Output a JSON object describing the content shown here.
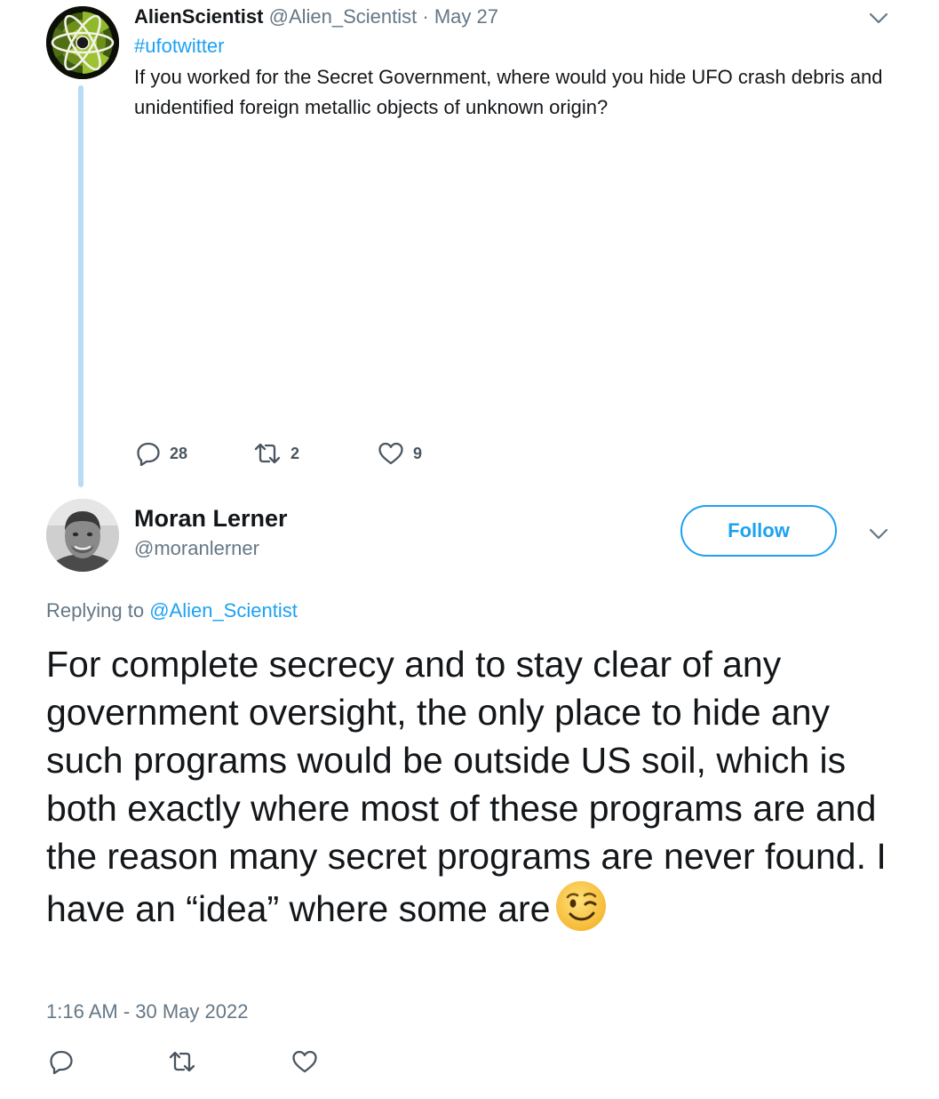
{
  "parent_tweet": {
    "author_name": "AlienScientist",
    "author_handle": "@Alien_Scientist",
    "separator": "·",
    "date": "May 27",
    "hashtag": "#ufotwitter",
    "text": "If you worked for the Secret Government, where would you hide UFO crash debris and unidentified foreign metallic objects of unknown origin?",
    "reply_count": "28",
    "retweet_count": "2",
    "like_count": "9",
    "icons": {
      "menu": "chevron-down-icon",
      "reply": "reply-icon",
      "retweet": "retweet-icon",
      "like": "heart-icon",
      "avatar": "atom-avatar"
    }
  },
  "reply_tweet": {
    "author_name": "Moran Lerner",
    "author_handle": "@moranlerner",
    "follow_label": "Follow",
    "replying_prefix": "Replying to ",
    "replying_to": "@Alien_Scientist",
    "text": "For complete secrecy and to stay clear of any government oversight, the only place to hide any such programs would be outside US soil, which is both exactly where most of these programs are and the reason many secret programs are never found. I have an “idea” where some are",
    "emoji": "winking-face-emoji",
    "timestamp": "1:16 AM - 30 May 2022",
    "icons": {
      "menu": "chevron-down-icon",
      "reply": "reply-icon",
      "retweet": "retweet-icon",
      "like": "heart-icon",
      "avatar": "user-photo-avatar"
    }
  },
  "colors": {
    "accent": "#1da1f2",
    "thread_line": "#b8dcf4",
    "secondary_text": "#657786",
    "primary_text": "#14171a"
  }
}
